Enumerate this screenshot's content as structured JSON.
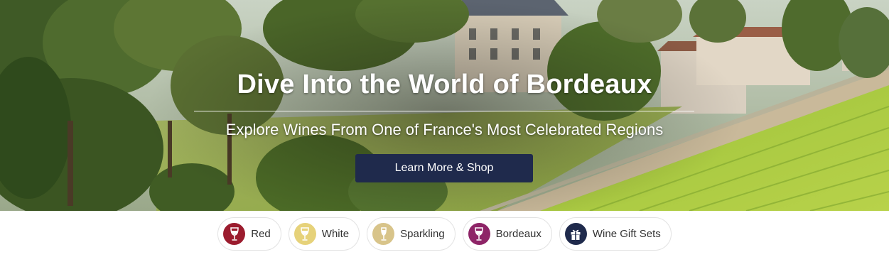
{
  "hero": {
    "title": "Dive Into the World of Bordeaux",
    "subtitle": "Explore Wines From One of France's Most Celebrated Regions",
    "cta_label": "Learn More & Shop",
    "cta_color": "#1f2a4c"
  },
  "categories": [
    {
      "label": "Red",
      "icon": "red-wine-glass-icon",
      "color": "#9b1c2e"
    },
    {
      "label": "White",
      "icon": "white-wine-glass-icon",
      "color": "#e6d27a"
    },
    {
      "label": "Sparkling",
      "icon": "sparkling-wine-glass-icon",
      "color": "#d8c48a"
    },
    {
      "label": "Bordeaux",
      "icon": "bordeaux-wine-glass-icon",
      "color": "#8e2467"
    },
    {
      "label": "Wine Gift Sets",
      "icon": "gift-icon",
      "color": "#1f2a4c"
    }
  ]
}
